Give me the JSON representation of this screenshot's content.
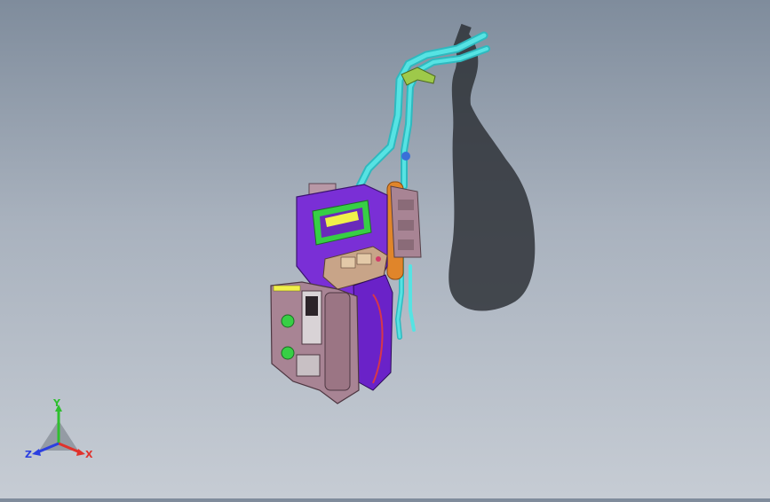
{
  "viewport": {
    "background_top": "#7f8c9c",
    "background_bottom": "#c6ccd4",
    "model_colors": {
      "purple": "#7a2fd6",
      "mauve": "#a88494",
      "cyan": "#41d6d6",
      "orange": "#e0852a",
      "yellow": "#f1f04a",
      "green": "#37cf45"
    }
  },
  "triad": {
    "x_label": "X",
    "y_label": "Y",
    "z_label": "Z",
    "x_color": "#e0322c",
    "y_color": "#2fbf2f",
    "z_color": "#2b3fe0"
  }
}
